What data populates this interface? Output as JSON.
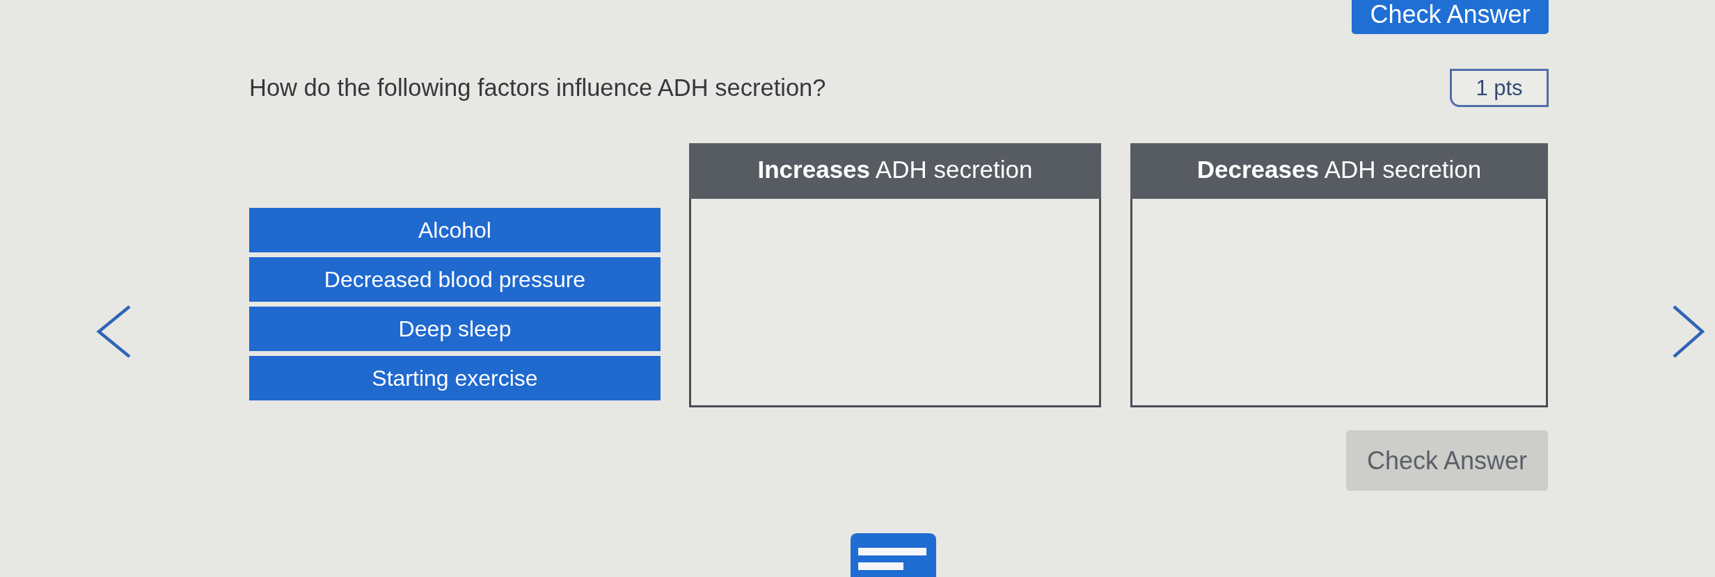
{
  "header": {
    "check_button": {
      "label": "Check Answer",
      "disabled": false
    }
  },
  "question": {
    "text": "How do the following factors influence ADH secretion?",
    "points": "1 pts"
  },
  "answer_items": [
    {
      "label": "Alcohol"
    },
    {
      "label": "Decreased blood pressure"
    },
    {
      "label": "Deep sleep"
    },
    {
      "label": "Starting exercise"
    }
  ],
  "drop_zones": [
    {
      "heading": "**Increases** ADH secretion"
    },
    {
      "heading": "**Decreases** ADH secretion"
    }
  ],
  "footer": {
    "check_button": {
      "label": "Check Answer",
      "disabled": true
    }
  }
}
